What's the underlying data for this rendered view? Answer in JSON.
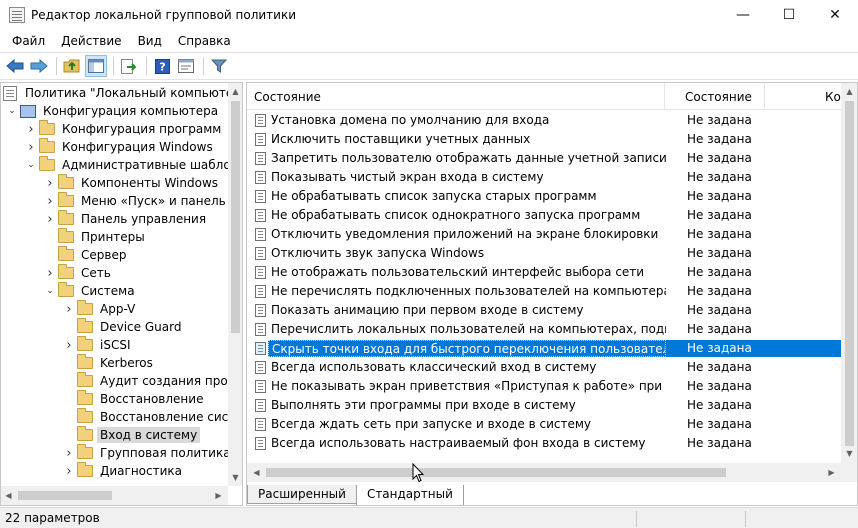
{
  "window": {
    "title": "Редактор локальной групповой политики",
    "min": "—",
    "max": "☐",
    "close": "✕"
  },
  "menu": [
    "Файл",
    "Действие",
    "Вид",
    "Справка"
  ],
  "tree": {
    "root": "Политика \"Локальный компьютер\"",
    "computer_config": "Конфигурация компьютера",
    "items": [
      {
        "label": "Конфигурация программ",
        "level": 2,
        "expanded": false
      },
      {
        "label": "Конфигурация Windows",
        "level": 2,
        "expanded": false
      },
      {
        "label": "Административные шаблоны",
        "level": 2,
        "expanded": true
      },
      {
        "label": "Компоненты Windows",
        "level": 3,
        "expanded": false
      },
      {
        "label": "Меню «Пуск» и панель задач",
        "level": 3,
        "expanded": false
      },
      {
        "label": "Панель управления",
        "level": 3,
        "expanded": false
      },
      {
        "label": "Принтеры",
        "level": 3,
        "leaf": true
      },
      {
        "label": "Сервер",
        "level": 3,
        "leaf": true
      },
      {
        "label": "Сеть",
        "level": 3,
        "expanded": false
      },
      {
        "label": "Система",
        "level": 3,
        "expanded": true
      },
      {
        "label": "App-V",
        "level": 4,
        "expanded": false
      },
      {
        "label": "Device Guard",
        "level": 4,
        "leaf": true
      },
      {
        "label": "iSCSI",
        "level": 4,
        "expanded": false
      },
      {
        "label": "Kerberos",
        "level": 4,
        "leaf": true
      },
      {
        "label": "Аудит создания процессов",
        "level": 4,
        "leaf": true
      },
      {
        "label": "Восстановление",
        "level": 4,
        "leaf": true
      },
      {
        "label": "Восстановление системы",
        "level": 4,
        "leaf": true
      },
      {
        "label": "Вход в систему",
        "level": 4,
        "leaf": true,
        "selected": true
      },
      {
        "label": "Групповая политика",
        "level": 4,
        "expanded": false
      },
      {
        "label": "Диагностика",
        "level": 4,
        "expanded": false
      }
    ]
  },
  "list": {
    "columns": [
      "Состояние",
      "Состояние",
      "Ко"
    ],
    "rows": [
      {
        "name": "Установка домена по умолчанию для входа",
        "state": "Не задана"
      },
      {
        "name": "Исключить поставщики учетных данных",
        "state": "Не задана"
      },
      {
        "name": "Запретить пользователю отображать данные учетной записи на экра...",
        "state": "Не задана"
      },
      {
        "name": "Показывать чистый экран входа в систему",
        "state": "Не задана"
      },
      {
        "name": "Не обрабатывать список запуска старых программ",
        "state": "Не задана"
      },
      {
        "name": "Не обрабатывать список однократного запуска программ",
        "state": "Не задана"
      },
      {
        "name": "Отключить уведомления приложений на экране блокировки",
        "state": "Не задана"
      },
      {
        "name": "Отключить звук запуска Windows",
        "state": "Не задана"
      },
      {
        "name": "Не отображать пользовательский интерфейс выбора сети",
        "state": "Не задана"
      },
      {
        "name": "Не перечислять подключенных пользователей на компьютерах, под...",
        "state": "Не задана"
      },
      {
        "name": "Показать анимацию при первом входе в систему",
        "state": "Не задана"
      },
      {
        "name": "Перечислить локальных пользователей на компьютерах, подключе...",
        "state": "Не задана"
      },
      {
        "name": "Скрыть точки входа для быстрого переключения пользователей",
        "state": "Не задана",
        "selected": true
      },
      {
        "name": "Всегда использовать классический вход в систему",
        "state": "Не задана"
      },
      {
        "name": "Не показывать экран приветствия «Приступая к работе» при входе в ...",
        "state": "Не задана"
      },
      {
        "name": "Выполнять эти программы при входе в систему",
        "state": "Не задана"
      },
      {
        "name": "Всегда ждать сеть при запуске и входе в систему",
        "state": "Не задана"
      },
      {
        "name": "Всегда использовать настраиваемый фон входа в систему",
        "state": "Не задана"
      }
    ]
  },
  "tabs": [
    "Расширенный",
    "Стандартный"
  ],
  "status": "22 параметров",
  "colors": {
    "accent": "#0078d7"
  }
}
